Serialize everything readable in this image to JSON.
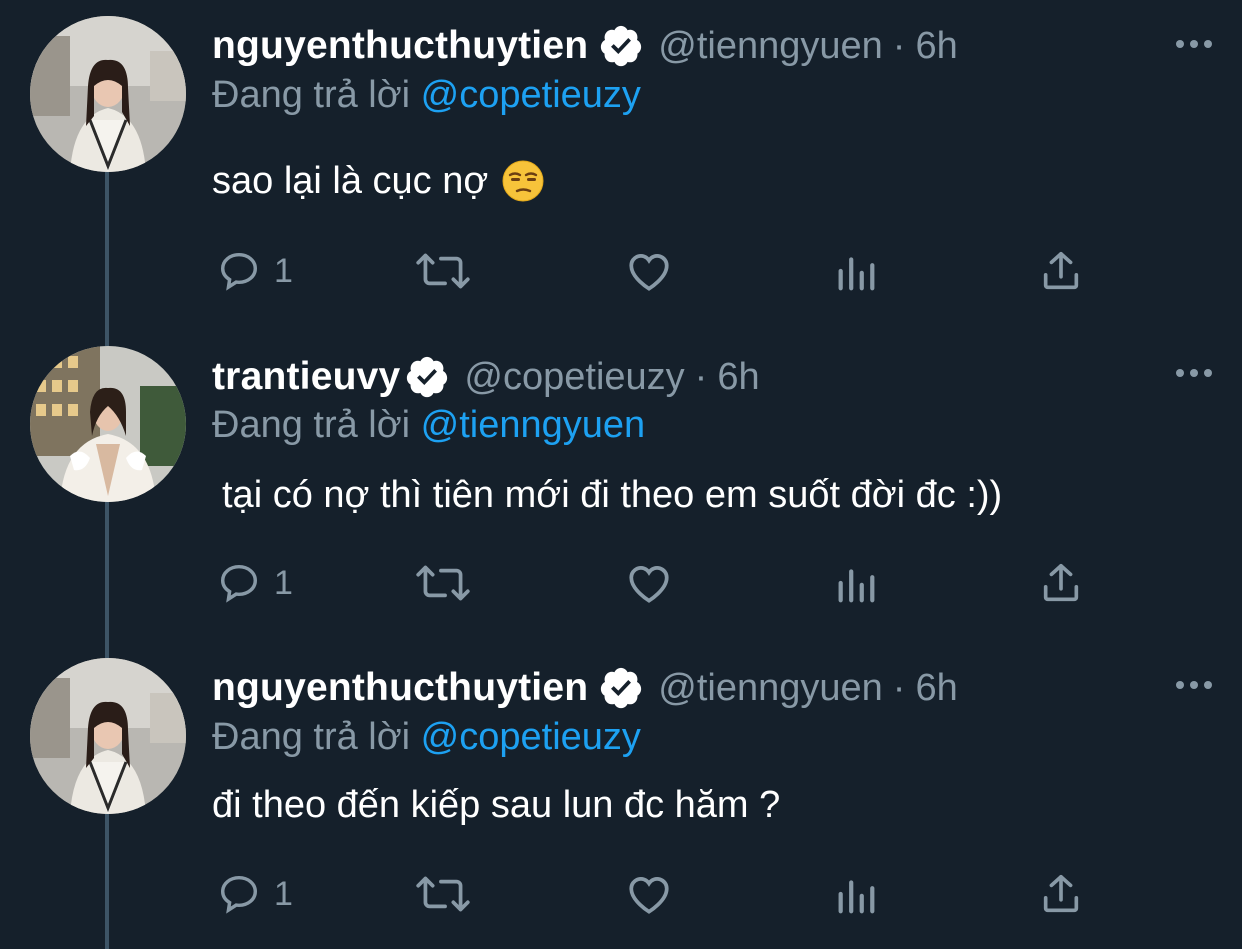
{
  "tweets": [
    {
      "name": "nguyenthucthuytien",
      "handle": "@tienngyuen",
      "separator": "·",
      "time": "6h",
      "reply_prefix": "Đang trả lời",
      "reply_to": "@copetieuzy",
      "text": "sao lại là cục nợ",
      "emoji": "unamused-face-emoji",
      "reply_count": "1"
    },
    {
      "name": "trantieuvy",
      "handle": "@copetieuzy",
      "separator": "·",
      "time": "6h",
      "reply_prefix": "Đang trả lời",
      "reply_to": "@tienngyuen",
      "text": "tại có nợ thì tiên mới đi theo em suốt đời đc :))",
      "reply_count": "1"
    },
    {
      "name": "nguyenthucthuytien",
      "handle": "@tienngyuen",
      "separator": "·",
      "time": "6h",
      "reply_prefix": "Đang trả lời",
      "reply_to": "@copetieuzy",
      "text": "đi theo đến kiếp sau lun đc hăm ?",
      "reply_count": "1"
    }
  ],
  "icons": {
    "reply": "reply-icon",
    "retweet": "retweet-icon",
    "like": "like-icon",
    "analytics": "analytics-icon",
    "share": "share-icon",
    "more": "more-icon",
    "verified": "verified-badge-icon"
  },
  "colors": {
    "background": "#15202b",
    "text": "#ffffff",
    "secondary": "#8899a6",
    "accent": "#1da1f2",
    "thread_line": "#3d5466"
  }
}
